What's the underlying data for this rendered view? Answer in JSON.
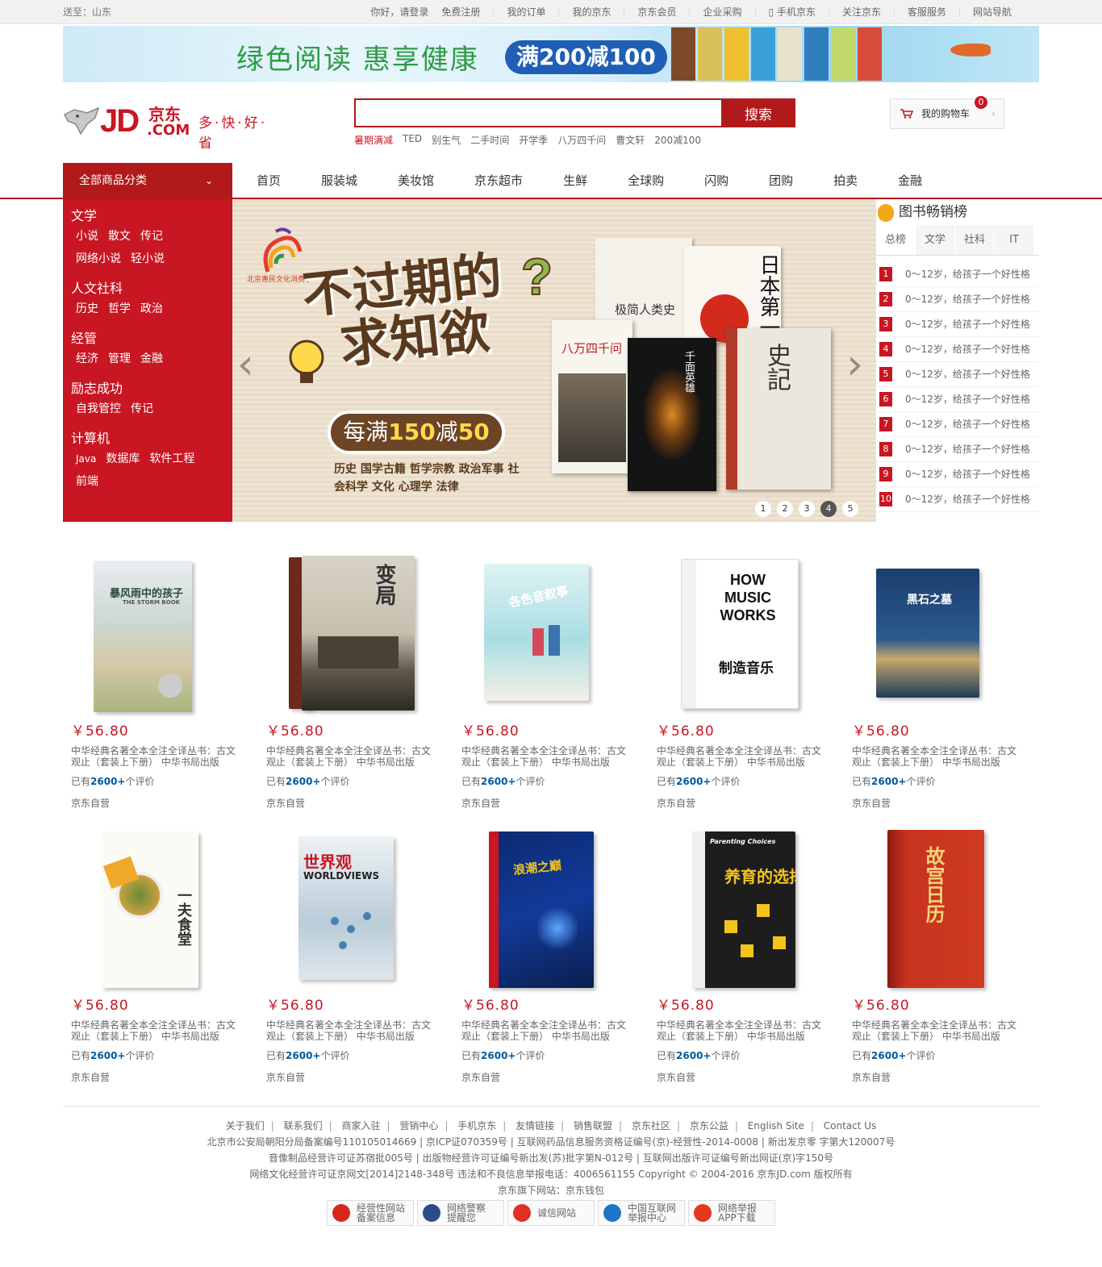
{
  "topbar": {
    "location": "送至：山东",
    "links": [
      "你好，请登录",
      "免费注册",
      "我的订单",
      "我的京东",
      "京东会员",
      "企业采购",
      "手机京东",
      "关注京东",
      "客服服务",
      "网站导航"
    ]
  },
  "banner": {
    "headline": "绿色阅读  惠享健康",
    "promo": "满200减100"
  },
  "logo": {
    "text": "JD",
    "cn": "京东",
    "com": ".COM",
    "slogan": "多·快·好·省"
  },
  "search": {
    "placeholder": "",
    "button_label": "搜索",
    "hotwords": [
      "暑期满减",
      "TED",
      "别生气",
      "二手时间",
      "开学季",
      "八万四千问",
      "曹文轩",
      "200减100"
    ]
  },
  "cart": {
    "label": "我的购物车",
    "count": "0"
  },
  "nav": {
    "all_label": "全部商品分类",
    "items": [
      "首页",
      "服装城",
      "美妆馆",
      "京东超市",
      "生鲜",
      "全球购",
      "闪购",
      "团购",
      "拍卖",
      "金融"
    ]
  },
  "categories": [
    {
      "title": "文学",
      "items": [
        "小说",
        "散文",
        "传记",
        "网络小说",
        "轻小说"
      ]
    },
    {
      "title": "人文社科",
      "items": [
        "历史",
        "哲学",
        "政治"
      ]
    },
    {
      "title": "经管",
      "items": [
        "经济",
        "管理",
        "金融"
      ]
    },
    {
      "title": "励志成功",
      "items": [
        "自我管控",
        "传记"
      ]
    },
    {
      "title": "计算机",
      "items": [
        "Java",
        "数据库",
        "软件工程",
        "前端"
      ]
    }
  ],
  "slider": {
    "title_line1": "不过期的",
    "title_line2": "求知欲",
    "promo_prefix": "每满",
    "promo_num1": "150",
    "promo_mid": "减",
    "promo_num2": "50",
    "subjects": "历史 国学古籍 哲学宗教 政治军事 社会科学 文化 心理学 法律",
    "logo_caption": "北京惠民文化消费季",
    "book_texts": [
      "极简人类史",
      "日本第一",
      "八万四千问",
      "千面英雄",
      "史記"
    ],
    "dots": [
      "1",
      "2",
      "3",
      "4",
      "5"
    ],
    "active_dot": "4"
  },
  "rank": {
    "title": "图书畅销榜",
    "tabs": [
      "总榜",
      "文学",
      "社科",
      "IT"
    ],
    "items": [
      "0～12岁，给孩子一个好性格",
      "0～12岁，给孩子一个好性格",
      "0～12岁，给孩子一个好性格",
      "0～12岁，给孩子一个好性格",
      "0～12岁，给孩子一个好性格",
      "0～12岁，给孩子一个好性格",
      "0～12岁，给孩子一个好性格",
      "0～12岁，给孩子一个好性格",
      "0～12岁，给孩子一个好性格",
      "0～12岁，给孩子一个好性格"
    ],
    "numbers": [
      "1",
      "2",
      "3",
      "4",
      "5",
      "6",
      "7",
      "8",
      "9",
      "10"
    ]
  },
  "products": [
    {
      "price": "￥56.80",
      "name": "中华经典名著全本全注全译丛书：古文观止（套装上下册） 中华书局出版",
      "cmt_prefix": "已有",
      "cmt_num": "2600+",
      "cmt_suffix": "个评价",
      "shop": "京东自营",
      "cover_title": "暴风雨中的孩子",
      "cover_sub": "THE STORM BOOK"
    },
    {
      "price": "￥56.80",
      "name": "中华经典名著全本全注全译丛书：古文观止（套装上下册） 中华书局出版",
      "cmt_prefix": "已有",
      "cmt_num": "2600+",
      "cmt_suffix": "个评价",
      "shop": "京东自营",
      "cover_title": "变局",
      "cover_sub": ""
    },
    {
      "price": "￥56.80",
      "name": "中华经典名著全本全注全译丛书：古文观止（套装上下册） 中华书局出版",
      "cmt_prefix": "已有",
      "cmt_num": "2600+",
      "cmt_suffix": "个评价",
      "shop": "京东自营",
      "cover_title": "各色音叙事",
      "cover_sub": ""
    },
    {
      "price": "￥56.80",
      "name": "中华经典名著全本全注全译丛书：古文观止（套装上下册） 中华书局出版",
      "cmt_prefix": "已有",
      "cmt_num": "2600+",
      "cmt_suffix": "个评价",
      "shop": "京东自营",
      "cover_title": "HOW MUSIC WORKS",
      "cover_sub": "制造音乐"
    },
    {
      "price": "￥56.80",
      "name": "中华经典名著全本全注全译丛书：古文观止（套装上下册） 中华书局出版",
      "cmt_prefix": "已有",
      "cmt_num": "2600+",
      "cmt_suffix": "个评价",
      "shop": "京东自营",
      "cover_title": "黑石之墓",
      "cover_sub": ""
    },
    {
      "price": "￥56.80",
      "name": "中华经典名著全本全注全译丛书：古文观止（套装上下册） 中华书局出版",
      "cmt_prefix": "已有",
      "cmt_num": "2600+",
      "cmt_suffix": "个评价",
      "shop": "京东自营",
      "cover_title": "一夫食堂",
      "cover_sub": ""
    },
    {
      "price": "￥56.80",
      "name": "中华经典名著全本全注全译丛书：古文观止（套装上下册） 中华书局出版",
      "cmt_prefix": "已有",
      "cmt_num": "2600+",
      "cmt_suffix": "个评价",
      "shop": "京东自营",
      "cover_title": "世界观",
      "cover_sub": "WORLDVIEWS"
    },
    {
      "price": "￥56.80",
      "name": "中华经典名著全本全注全译丛书：古文观止（套装上下册） 中华书局出版",
      "cmt_prefix": "已有",
      "cmt_num": "2600+",
      "cmt_suffix": "个评价",
      "shop": "京东自营",
      "cover_title": "浪潮之巅",
      "cover_sub": ""
    },
    {
      "price": "￥56.80",
      "name": "中华经典名著全本全注全译丛书：古文观止（套装上下册） 中华书局出版",
      "cmt_prefix": "已有",
      "cmt_num": "2600+",
      "cmt_suffix": "个评价",
      "shop": "京东自营",
      "cover_title": "养育的选择",
      "cover_sub": "Parenting Choices"
    },
    {
      "price": "￥56.80",
      "name": "中华经典名著全本全注全译丛书：古文观止（套装上下册） 中华书局出版",
      "cmt_prefix": "已有",
      "cmt_num": "2600+",
      "cmt_suffix": "个评价",
      "shop": "京东自营",
      "cover_title": "故宫日历",
      "cover_sub": ""
    }
  ],
  "footer": {
    "links": [
      "关于我们",
      "联系我们",
      "商家入驻",
      "营销中心",
      "手机京东",
      "友情链接",
      "销售联盟",
      "京东社区",
      "京东公益",
      "English Site",
      "Contact Us"
    ],
    "line2": "北京市公安局朝阳分局备案编号110105014669  |  京ICP证070359号  |  互联网药品信息服务资格证编号(京)-经营性-2014-0008  |  新出发京零 字第大120007号",
    "line3": "音像制品经营许可证苏宿批005号  |  出版物经营许可证编号新出发(苏)批字第N-012号  |  互联网出版许可证编号新出网证(京)字150号",
    "line4": "网络文化经营许可证京网文[2014]2148-348号  违法和不良信息举报电话：4006561155  Copyright © 2004-2016  京东JD.com 版权所有",
    "line5": "京东旗下网站：京东钱包",
    "badges": [
      {
        "l1": "经营性网站",
        "l2": "备案信息"
      },
      {
        "l1": "网络警察",
        "l2": "提醒您"
      },
      {
        "l1": "诚信网站",
        "l2": ""
      },
      {
        "l1": "中国互联网",
        "l2": "举报中心"
      },
      {
        "l1": "网络举报",
        "l2": "APP下载"
      }
    ]
  },
  "colors": {
    "brand": "#c81623",
    "nav_red": "#b1191a",
    "link_blue": "#005aa0"
  }
}
